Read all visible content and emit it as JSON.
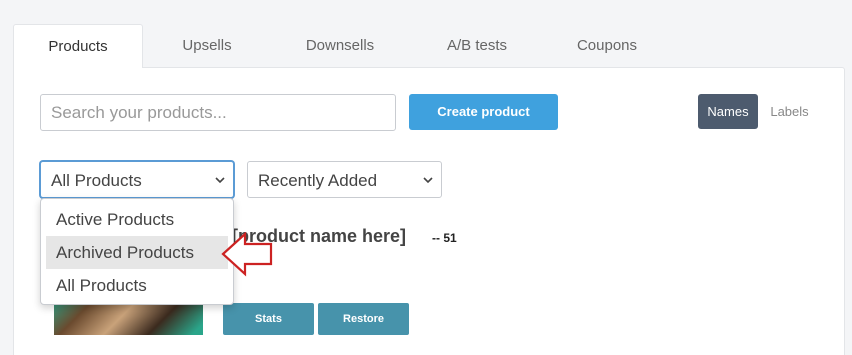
{
  "tabs": [
    {
      "label": "Products",
      "active": true
    },
    {
      "label": "Upsells",
      "active": false
    },
    {
      "label": "Downsells",
      "active": false
    },
    {
      "label": "A/B tests",
      "active": false
    },
    {
      "label": "Coupons",
      "active": false
    }
  ],
  "search": {
    "placeholder": "Search your products..."
  },
  "toolbar": {
    "create_label": "Create product",
    "names_label": "Names",
    "labels_label": "Labels"
  },
  "filters": {
    "status_value": "All Products",
    "sort_value": "Recently Added",
    "status_options": [
      "Active Products",
      "Archived Products",
      "All Products"
    ],
    "highlighted_option": "Archived Products"
  },
  "product": {
    "title": "[product name here]",
    "count": "-- 51",
    "stats_label": "Stats",
    "restore_label": "Restore"
  },
  "colors": {
    "accent": "#3fa1de",
    "names_active": "#4d5b6e",
    "action_button": "#4793ab",
    "annotation_arrow": "#cc2222"
  }
}
